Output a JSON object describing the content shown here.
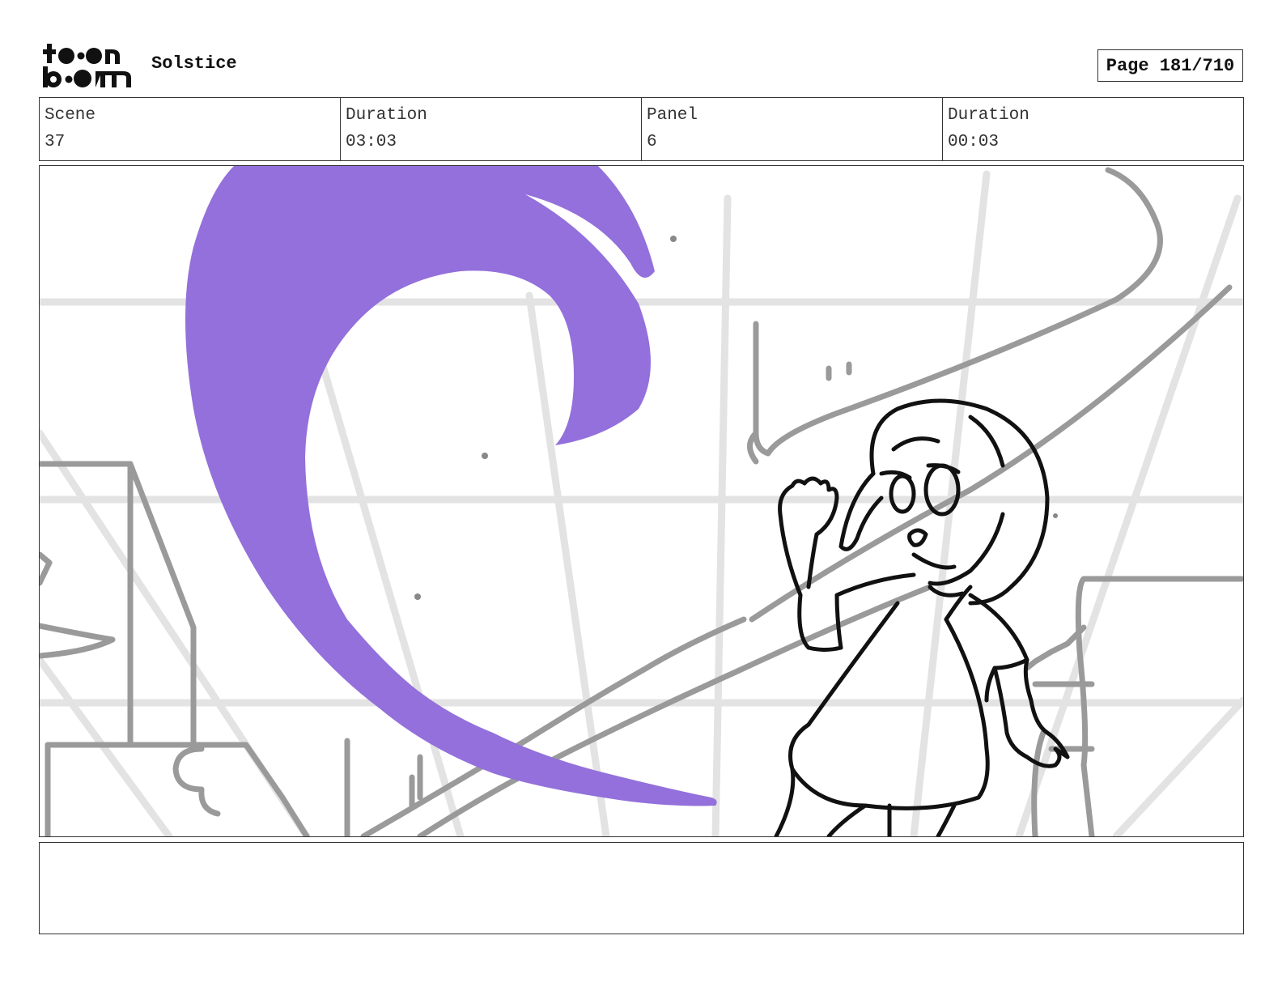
{
  "header": {
    "logo_text": "toon boom",
    "project_title": "Solstice",
    "page_label": "Page 181/710"
  },
  "info": {
    "scene_label": "Scene",
    "scene_value": "37",
    "scene_duration_label": "Duration",
    "scene_duration_value": "03:03",
    "panel_label": "Panel",
    "panel_value": "6",
    "panel_duration_label": "Duration",
    "panel_duration_value": "00:03"
  },
  "panel_image": {
    "description_icon": "storyboard-sketch",
    "accent_color": "#9370DB",
    "line_color": "#111111",
    "background_line_color": "#999999",
    "guide_line_color": "#e3e3e3"
  },
  "notes": {
    "text": ""
  }
}
